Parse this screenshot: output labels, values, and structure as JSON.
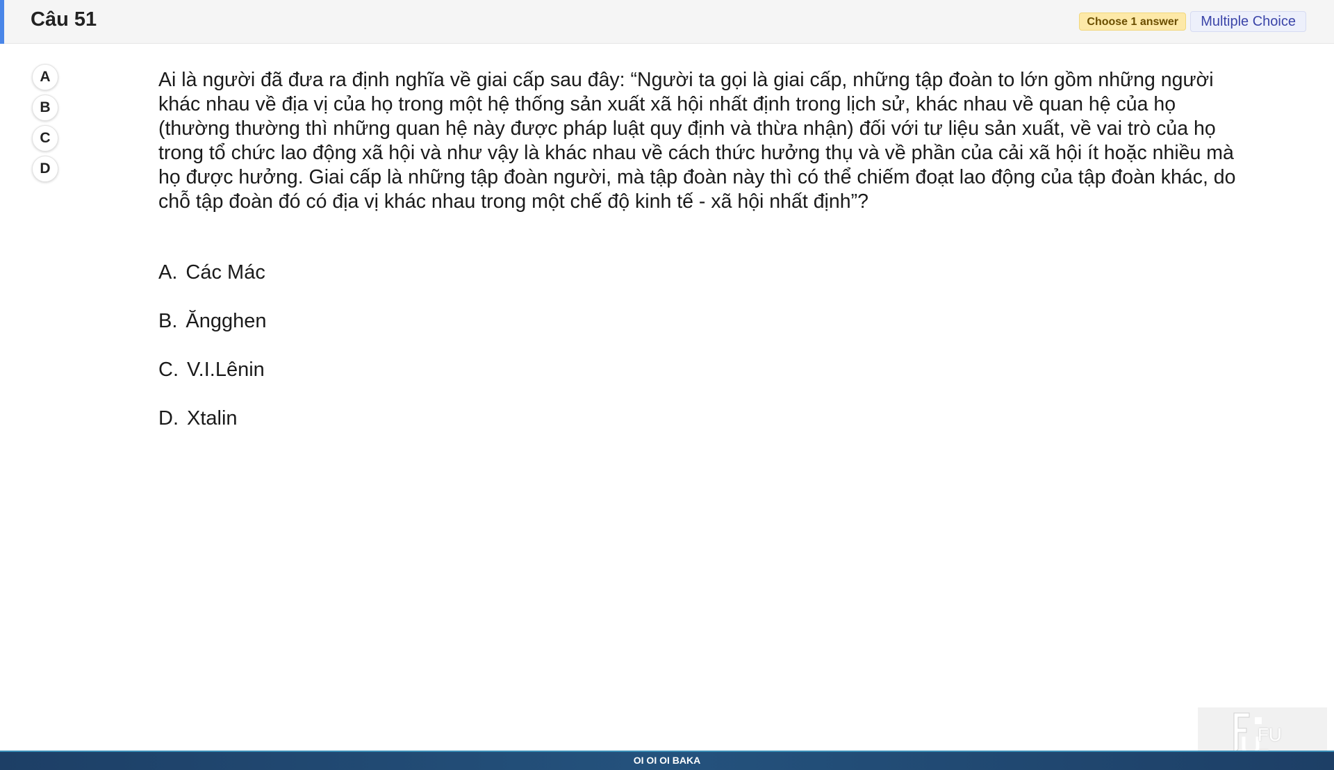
{
  "header": {
    "title": "Câu 51",
    "choose_badge": "Choose 1 answer",
    "type_badge": "Multiple Choice"
  },
  "option_buttons": [
    "A",
    "B",
    "C",
    "D"
  ],
  "question": {
    "text": "Ai là người đã đưa ra định nghĩa về giai cấp sau đây: “Người ta gọi là giai cấp, những tập đoàn to lớn gồm những người khác nhau về địa vị của họ trong một hệ thống sản xuất xã hội nhất định trong lịch sử, khác nhau về quan hệ của họ (thường thường thì những quan hệ này được pháp luật quy định và thừa nhận) đối với tư liệu sản xuất, về vai trò của họ trong tổ chức lao động xã hội và như vậy là khác nhau về cách thức hưởng thụ và về phần của cải xã hội ít hoặc nhiều mà họ được hưởng. Giai cấp là những tập đoàn người, mà tập đoàn này thì có thể chiếm đoạt lao động của tập đoàn khác, do chỗ tập đoàn đó có địa vị khác nhau trong một chế độ kinh tế - xã hội nhất định”?"
  },
  "answers": [
    {
      "letter": "A.",
      "text": "Các Mác"
    },
    {
      "letter": "B.",
      "text": "Ăngghen"
    },
    {
      "letter": "C.",
      "text": "V.I.Lênin"
    },
    {
      "letter": "D.",
      "text": "Xtalin"
    }
  ],
  "footer": {
    "text": "OI OI OI BAKA"
  },
  "logo": {
    "text": "FU Exam"
  },
  "colors": {
    "accent": "#4a86e8",
    "footer": "#1d3f66",
    "choose_badge_bg": "#fde9a8",
    "type_badge_text": "#3a44a8"
  }
}
